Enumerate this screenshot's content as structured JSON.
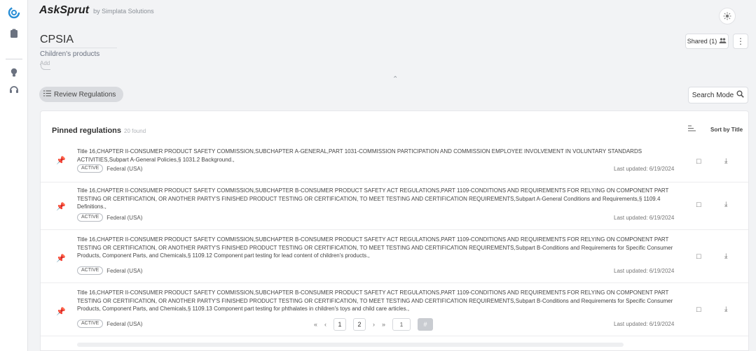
{
  "brand": {
    "name": "AskSprut",
    "sub": "by Simplata Solutions"
  },
  "document": {
    "title": "CPSIA",
    "description": "Children's products",
    "add_label": "Add"
  },
  "header_buttons": {
    "shared": "Shared (1)"
  },
  "toolbar": {
    "review": "Review Regulations",
    "search_mode": "Search Mode"
  },
  "pinned": {
    "title": "Pinned regulations",
    "count": "20 found",
    "sort": "Sort by Title",
    "rows": [
      {
        "text": "Title 16,CHAPTER II-CONSUMER PRODUCT SAFETY COMMISSION,SUBCHAPTER A-GENERAL,PART 1031-COMMISSION PARTICIPATION AND COMMISSION EMPLOYEE INVOLVEMENT IN VOLUNTARY STANDARDS ACTIVITIES,Subpart A-General Policies,§ 1031.2 Background.,",
        "status": "ACTIVE",
        "jurisdiction": "Federal (USA)",
        "updated": "Last updated: 6/19/2024"
      },
      {
        "text": "Title 16,CHAPTER II-CONSUMER PRODUCT SAFETY COMMISSION,SUBCHAPTER B-CONSUMER PRODUCT SAFETY ACT REGULATIONS,PART 1109-CONDITIONS AND REQUIREMENTS FOR RELYING ON COMPONENT PART TESTING OR CERTIFICATION, OR ANOTHER PARTY'S FINISHED PRODUCT TESTING OR CERTIFICATION, TO MEET TESTING AND CERTIFICATION REQUIREMENTS,Subpart A-General Conditions and Requirements,§ 1109.4 Definitions.,",
        "status": "ACTIVE",
        "jurisdiction": "Federal (USA)",
        "updated": "Last updated: 6/19/2024"
      },
      {
        "text": "Title 16,CHAPTER II-CONSUMER PRODUCT SAFETY COMMISSION,SUBCHAPTER B-CONSUMER PRODUCT SAFETY ACT REGULATIONS,PART 1109-CONDITIONS AND REQUIREMENTS FOR RELYING ON COMPONENT PART TESTING OR CERTIFICATION, OR ANOTHER PARTY'S FINISHED PRODUCT TESTING OR CERTIFICATION, TO MEET TESTING AND CERTIFICATION REQUIREMENTS,Subpart B-Conditions and Requirements for Specific Consumer Products, Component Parts, and Chemicals,§ 1109.12 Component part testing for lead content of children's products.,",
        "status": "ACTIVE",
        "jurisdiction": "Federal (USA)",
        "updated": "Last updated: 6/19/2024"
      },
      {
        "text": "Title 16,CHAPTER II-CONSUMER PRODUCT SAFETY COMMISSION,SUBCHAPTER B-CONSUMER PRODUCT SAFETY ACT REGULATIONS,PART 1109-CONDITIONS AND REQUIREMENTS FOR RELYING ON COMPONENT PART TESTING OR CERTIFICATION, OR ANOTHER PARTY'S FINISHED PRODUCT TESTING OR CERTIFICATION, TO MEET TESTING AND CERTIFICATION REQUIREMENTS,Subpart B-Conditions and Requirements for Specific Consumer Products, Component Parts, and Chemicals,§ 1109.13 Component part testing for phthalates in children's toys and child care articles.,",
        "status": "ACTIVE",
        "jurisdiction": "Federal (USA)",
        "updated": "Last updated: 6/19/2024"
      }
    ]
  },
  "pagination": {
    "pages": [
      "1",
      "2"
    ],
    "current_input": "1"
  },
  "icons": {
    "logo": "spiral-logo-icon",
    "documents": "clipboard-icon",
    "idea": "lightbulb-icon",
    "support": "headset-icon",
    "settings": "sun-icon",
    "users": "users-icon",
    "more": "kebab-icon",
    "review": "list-check-icon",
    "search": "search-icon",
    "sort": "sort-lines-icon",
    "pin": "pin-icon",
    "comment": "comment-icon",
    "download": "download-icon"
  },
  "colors": {
    "logo": "#2b8fd6",
    "background": "#f2f3f5",
    "panel": "#ffffff"
  }
}
